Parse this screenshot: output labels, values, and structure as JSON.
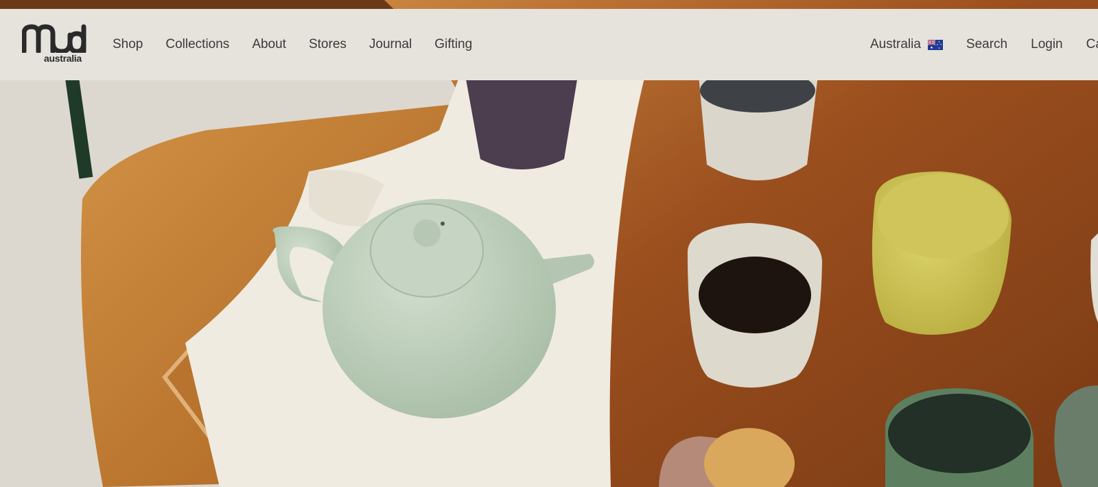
{
  "brand": {
    "logo_mark": "mud",
    "logo_sub": "australia",
    "logo_icon": "mud-australia-logo"
  },
  "nav": {
    "primary": [
      {
        "label": "Shop"
      },
      {
        "label": "Collections"
      },
      {
        "label": "About"
      },
      {
        "label": "Stores"
      },
      {
        "label": "Journal"
      },
      {
        "label": "Gifting"
      }
    ],
    "secondary": {
      "region_label": "Australia",
      "region_icon": "australian-flag-icon",
      "search_label": "Search",
      "login_label": "Login",
      "cart_label": "Cart"
    }
  },
  "colors": {
    "header_bg": "#e6e3dd",
    "nav_text": "#3a3a3a",
    "table_wood": "#9a4f1c",
    "teapot": "#bfcfbc"
  },
  "hero": {
    "image": "teapot-and-ceramic-cups-on-wooden-table"
  }
}
